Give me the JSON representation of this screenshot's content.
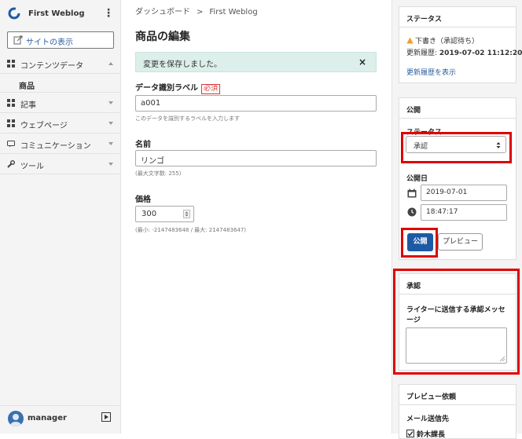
{
  "sidebar": {
    "site_name": "First Weblog",
    "view_site_label": "サイトの表示",
    "nav": [
      {
        "label": "コンテンツデータ",
        "icon": "grid-icon"
      },
      {
        "label": "記事",
        "icon": "grid-icon"
      },
      {
        "label": "ウェブページ",
        "icon": "grid-icon"
      },
      {
        "label": "コミュニケーション",
        "icon": "chat-icon"
      },
      {
        "label": "ツール",
        "icon": "wrench-icon"
      }
    ],
    "sub_item": "商品",
    "user_name": "manager"
  },
  "breadcrumb": {
    "home": "ダッシュボード",
    "separator": ">",
    "current": "First Weblog"
  },
  "page_title": "商品の編集",
  "alert": {
    "message": "変更を保存しました。",
    "close": "×"
  },
  "form": {
    "label_field": {
      "label": "データ識別ラベル",
      "required": "必須",
      "value": "a001",
      "help": "このデータを識別するラベルを入力します"
    },
    "name_field": {
      "label": "名前",
      "value": "リンゴ",
      "help": "(最大文字数: 255)"
    },
    "price_field": {
      "label": "価格",
      "value": "300",
      "help": "(最小: -2147483648 / 最大: 2147483647)"
    }
  },
  "status_panel": {
    "title": "ステータス",
    "state": "下書き（承認待ち）",
    "updated_label": "更新履歴:",
    "updated_value": "2019-07-02 11:12:20",
    "history_link": "更新履歴を表示"
  },
  "publish_panel": {
    "title": "公開",
    "status_label": "ステータス",
    "status_value": "承認",
    "date_label": "公開日",
    "date_value": "2019-07-01",
    "time_value": "18:47:17",
    "publish_button": "公開",
    "preview_button": "プレビュー"
  },
  "approval_panel": {
    "title": "承認",
    "message_label": "ライターに送信する承認メッセージ"
  },
  "preview_request_panel": {
    "title": "プレビュー依頼",
    "mail_label": "メール送信先",
    "recipient": "鈴木課長"
  },
  "colors": {
    "accent": "#1d5aa6",
    "highlight": "#e00000",
    "alert_bg": "#dcefea",
    "link": "#2d5e9e"
  }
}
